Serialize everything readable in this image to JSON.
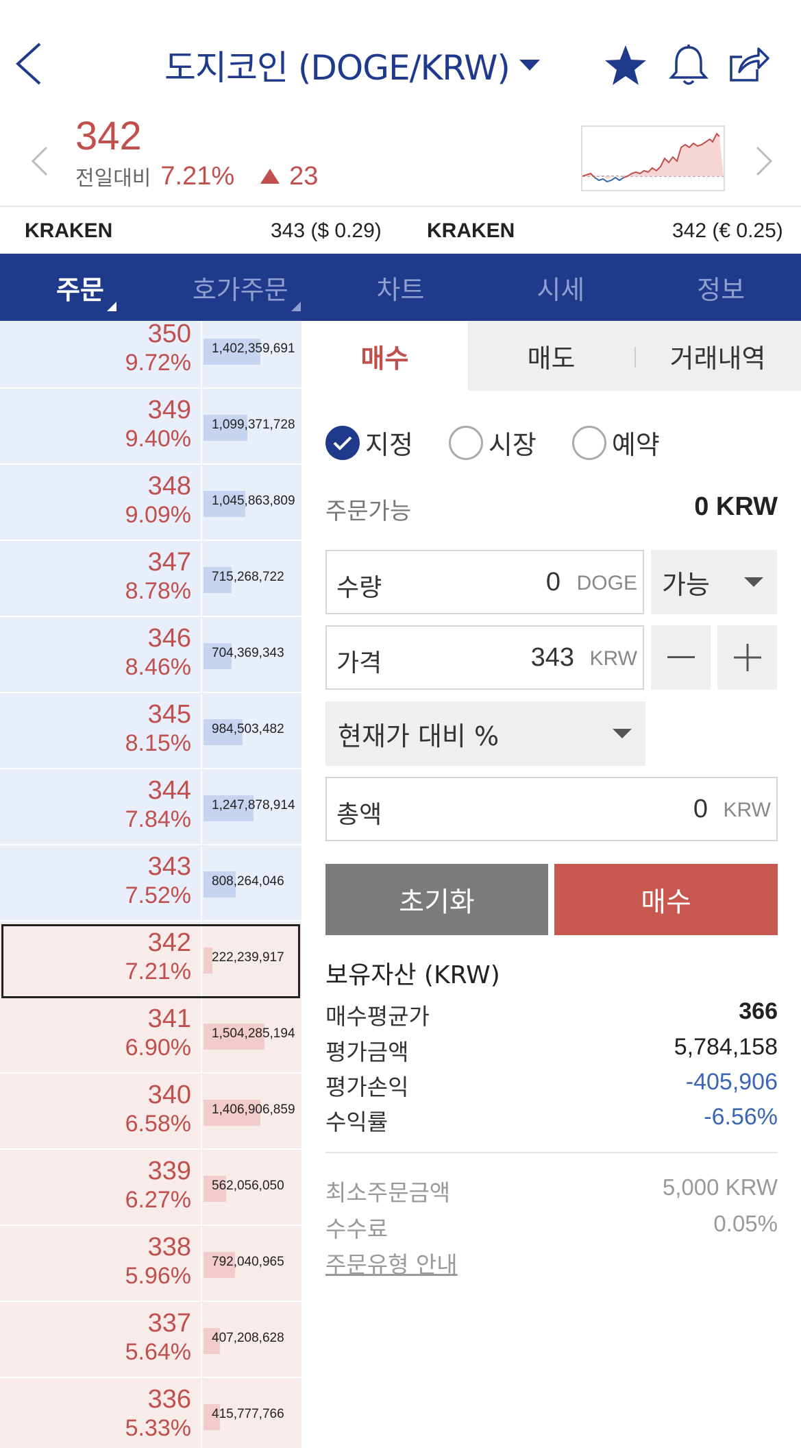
{
  "header": {
    "title": "도지코인 (DOGE/KRW)",
    "icons": [
      "back-icon",
      "caret-down-icon",
      "star-icon",
      "bell-icon",
      "share-icon"
    ]
  },
  "summary": {
    "price": "342",
    "change_label": "전일대비",
    "change_pct": "7.21%",
    "change_val": "23"
  },
  "exchanges": [
    {
      "name": "KRAKEN",
      "value": "343 ($ 0.29)"
    },
    {
      "name": "KRAKEN",
      "value": "342 (€ 0.25)"
    }
  ],
  "tabs": [
    "주문",
    "호가주문",
    "차트",
    "시세",
    "정보"
  ],
  "orderbook": [
    {
      "price": "350",
      "pct": "9.72%",
      "vol": "1,402,359,691",
      "side": "sell",
      "bar": 0.58
    },
    {
      "price": "349",
      "pct": "9.40%",
      "vol": "1,099,371,728",
      "side": "sell",
      "bar": 0.45
    },
    {
      "price": "348",
      "pct": "9.09%",
      "vol": "1,045,863,809",
      "side": "sell",
      "bar": 0.43
    },
    {
      "price": "347",
      "pct": "8.78%",
      "vol": "715,268,722",
      "side": "sell",
      "bar": 0.29
    },
    {
      "price": "346",
      "pct": "8.46%",
      "vol": "704,369,343",
      "side": "sell",
      "bar": 0.29
    },
    {
      "price": "345",
      "pct": "8.15%",
      "vol": "984,503,482",
      "side": "sell",
      "bar": 0.4
    },
    {
      "price": "344",
      "pct": "7.84%",
      "vol": "1,247,878,914",
      "side": "sell",
      "bar": 0.51
    },
    {
      "price": "343",
      "pct": "7.52%",
      "vol": "808,264,046",
      "side": "sell",
      "bar": 0.33
    },
    {
      "price": "342",
      "pct": "7.21%",
      "vol": "222,239,917",
      "side": "buy",
      "bar": 0.09
    },
    {
      "price": "341",
      "pct": "6.90%",
      "vol": "1,504,285,194",
      "side": "buy",
      "bar": 0.62
    },
    {
      "price": "340",
      "pct": "6.58%",
      "vol": "1,406,906,859",
      "side": "buy",
      "bar": 0.58
    },
    {
      "price": "339",
      "pct": "6.27%",
      "vol": "562,056,050",
      "side": "buy",
      "bar": 0.23
    },
    {
      "price": "338",
      "pct": "5.96%",
      "vol": "792,040,965",
      "side": "buy",
      "bar": 0.32
    },
    {
      "price": "337",
      "pct": "5.64%",
      "vol": "407,208,628",
      "side": "buy",
      "bar": 0.17
    },
    {
      "price": "336",
      "pct": "5.33%",
      "vol": "415,777,766",
      "side": "buy",
      "bar": 0.17
    }
  ],
  "panel": {
    "side_tabs": [
      "매수",
      "매도",
      "거래내역"
    ],
    "order_types": [
      {
        "label": "지정",
        "checked": true
      },
      {
        "label": "시장",
        "checked": false
      },
      {
        "label": "예약",
        "checked": false
      }
    ],
    "avail_label": "주문가능",
    "avail_value": "0 KRW",
    "qty": {
      "label": "수량",
      "value": "0",
      "unit": "DOGE",
      "dropdown": "가능"
    },
    "price": {
      "label": "가격",
      "value": "343",
      "unit": "KRW"
    },
    "percent_select": "현재가 대비 %",
    "total": {
      "label": "총액",
      "value": "0",
      "unit": "KRW"
    },
    "reset_label": "초기화",
    "buy_label": "매수",
    "assets_title": "보유자산 (KRW)",
    "assets": [
      {
        "label": "매수평균가",
        "value": "366",
        "style": "bold"
      },
      {
        "label": "평가금액",
        "value": "5,784,158",
        "style": ""
      },
      {
        "label": "평가손익",
        "value": "-405,906",
        "style": "neg"
      },
      {
        "label": "수익률",
        "value": "-6.56%",
        "style": "neg"
      }
    ],
    "info": [
      {
        "label": "최소주문금액",
        "value": "5,000 KRW"
      },
      {
        "label": "수수료",
        "value": "0.05%"
      }
    ],
    "guide_link": "주문유형 안내"
  },
  "colors": {
    "brand": "#1f3a8a",
    "up": "#c0504d",
    "down": "#3a67b0"
  }
}
